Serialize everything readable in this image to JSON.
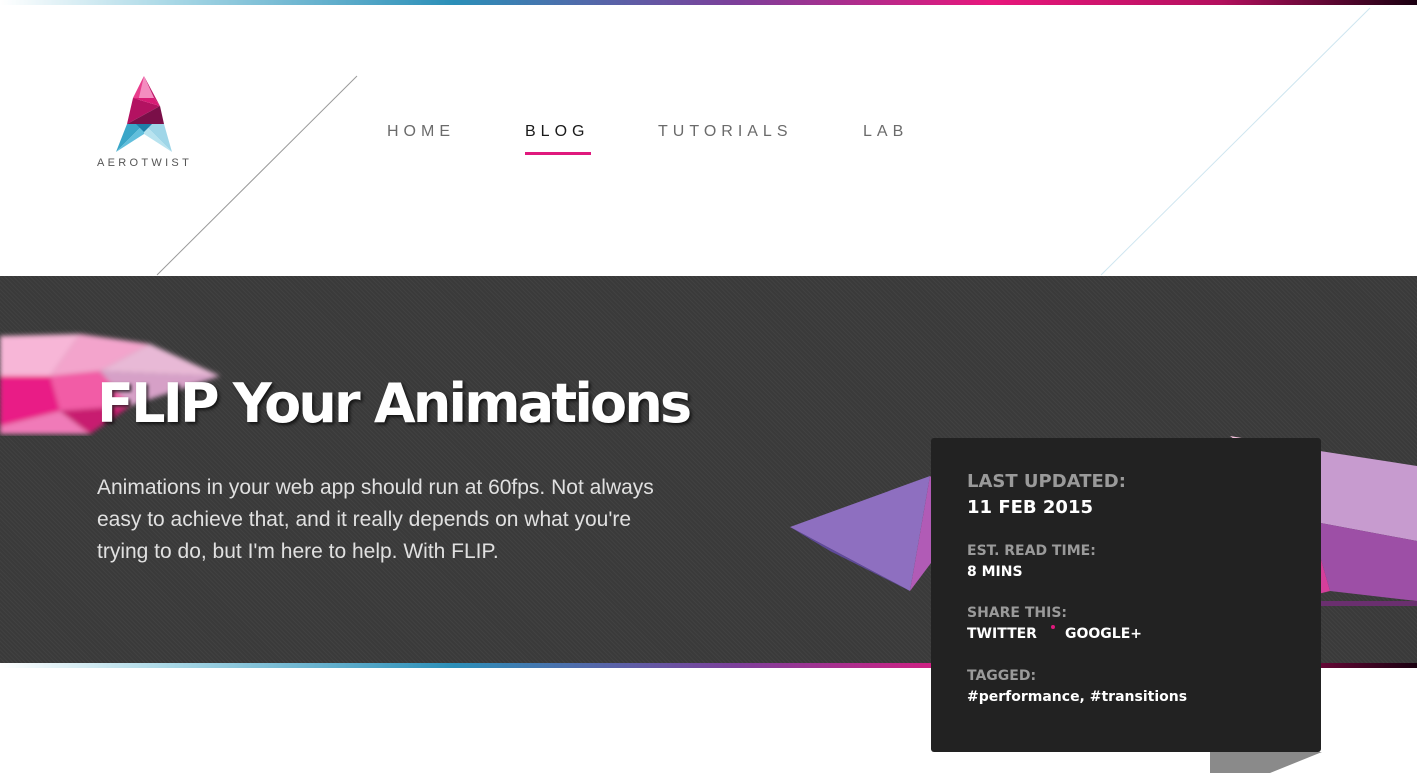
{
  "brand": {
    "name": "AEROTWIST",
    "accent_color": "#e0197d"
  },
  "nav": {
    "items": [
      {
        "label": "HOME",
        "active": false
      },
      {
        "label": "BLOG",
        "active": true
      },
      {
        "label": "TUTORIALS",
        "active": false
      },
      {
        "label": "LAB",
        "active": false
      }
    ]
  },
  "hero": {
    "title": "FLIP Your Animations",
    "intro": "Animations in your web app should run at 60fps. Not always easy to achieve that, and it really depends on what you're trying to do, but I'm here to help. With FLIP."
  },
  "info_card": {
    "last_updated_label": "LAST UPDATED:",
    "last_updated_value": "11 FEB 2015",
    "read_time_label": "EST. READ TIME:",
    "read_time_value": "8 MINS",
    "share_label": "SHARE THIS:",
    "share_links": [
      "TWITTER",
      "GOOGLE+"
    ],
    "tagged_label": "TAGGED:",
    "tags": "#performance, #transitions"
  }
}
